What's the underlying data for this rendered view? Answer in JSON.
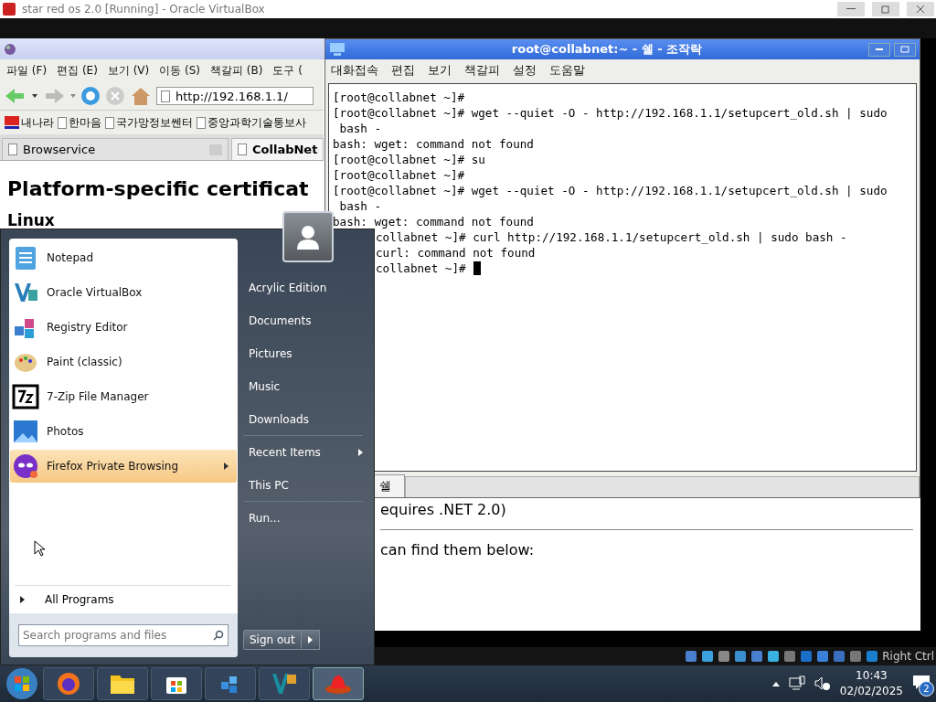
{
  "host_window": {
    "title": "star red os 2.0 [Running] - Oracle VirtualBox"
  },
  "browser": {
    "menu": [
      "파일 (F)",
      "편집 (E)",
      "보기 (V)",
      "이동 (S)",
      "책갈피 (B)",
      "도구 ("
    ],
    "url": "http://192.168.1.1/",
    "bookmarks": [
      "내나라",
      "한마음",
      "국가망정보쎈터",
      "중앙과학기술통보사"
    ],
    "tabs": [
      {
        "label": "Browservice",
        "selected": false
      },
      {
        "label": "CollabNet",
        "selected": true
      }
    ],
    "heading": "Platform-specific certificat",
    "subheading": "Linux",
    "fragments": [
      "equires .NET 2.0)",
      "can find them below:"
    ]
  },
  "terminal": {
    "title": "root@collabnet:~ - 쉘 - 조작락",
    "menu": [
      "대화접속",
      "편집",
      "보기",
      "책갈피",
      "설정",
      "도움말"
    ],
    "lines": [
      {
        "text": "[root@collabnet ~]#",
        "kind": "line",
        "cursor": false
      },
      {
        "text": "[root@collabnet ~]# wget --quiet -O - http://192.168.1.1/setupcert_old.sh | sudo",
        "kind": "line",
        "cursor": false
      },
      {
        "text": " bash -",
        "kind": "line",
        "cursor": false
      },
      {
        "text": "bash: wget: command not found",
        "kind": "line",
        "cursor": false
      },
      {
        "text": "[root@collabnet ~]# su",
        "kind": "line",
        "cursor": false
      },
      {
        "text": "[root@collabnet ~]#",
        "kind": "line",
        "cursor": false
      },
      {
        "text": "[root@collabnet ~]# wget --quiet -O - http://192.168.1.1/setupcert_old.sh | sudo",
        "kind": "line",
        "cursor": false
      },
      {
        "text": " bash -",
        "kind": "line",
        "cursor": false
      },
      {
        "text": "bash: wget: command not found",
        "kind": "line",
        "cursor": false
      },
      {
        "text": "collabnet ~]# curl http://192.168.1.1/setupcert_old.sh | sudo bash -",
        "kind": "cut-prompt",
        "cursor": false
      },
      {
        "text": "curl: command not found",
        "kind": "cut-output",
        "cursor": false
      },
      {
        "text": "collabnet ~]#",
        "kind": "cut-prompt",
        "cursor": true
      }
    ],
    "tabs": [
      {
        "label": "쉘",
        "selected": true
      }
    ]
  },
  "start_menu": {
    "programs": [
      {
        "label": "Notepad",
        "selected": false,
        "submenu": false
      },
      {
        "label": "Oracle VirtualBox",
        "selected": false,
        "submenu": false
      },
      {
        "label": "Registry Editor",
        "selected": false,
        "submenu": false
      },
      {
        "label": "Paint (classic)",
        "selected": false,
        "submenu": false
      },
      {
        "label": "7-Zip File Manager",
        "selected": false,
        "submenu": false
      },
      {
        "label": "Photos",
        "selected": false,
        "submenu": false
      },
      {
        "label": "Firefox Private Browsing",
        "selected": true,
        "submenu": true
      }
    ],
    "all_programs": "All Programs",
    "search": {
      "placeholder": "Search programs and files"
    },
    "places": [
      {
        "label": "Acrylic Edition",
        "submenu": false,
        "separator_after": false
      },
      {
        "label": "Documents",
        "submenu": false,
        "separator_after": false
      },
      {
        "label": "Pictures",
        "submenu": false,
        "separator_after": false
      },
      {
        "label": "Music",
        "submenu": false,
        "separator_after": false
      },
      {
        "label": "Downloads",
        "submenu": false,
        "separator_after": true
      },
      {
        "label": "Recent Items",
        "submenu": true,
        "separator_after": false
      },
      {
        "label": "This PC",
        "submenu": false,
        "separator_after": true
      },
      {
        "label": "Run...",
        "submenu": false,
        "separator_after": false
      }
    ],
    "sign_out": "Sign out"
  },
  "vbox_status": {
    "host_key": "Right Ctrl"
  },
  "taskbar": {
    "time": "10:43",
    "date": "02/02/2025",
    "notifications": "2"
  }
}
